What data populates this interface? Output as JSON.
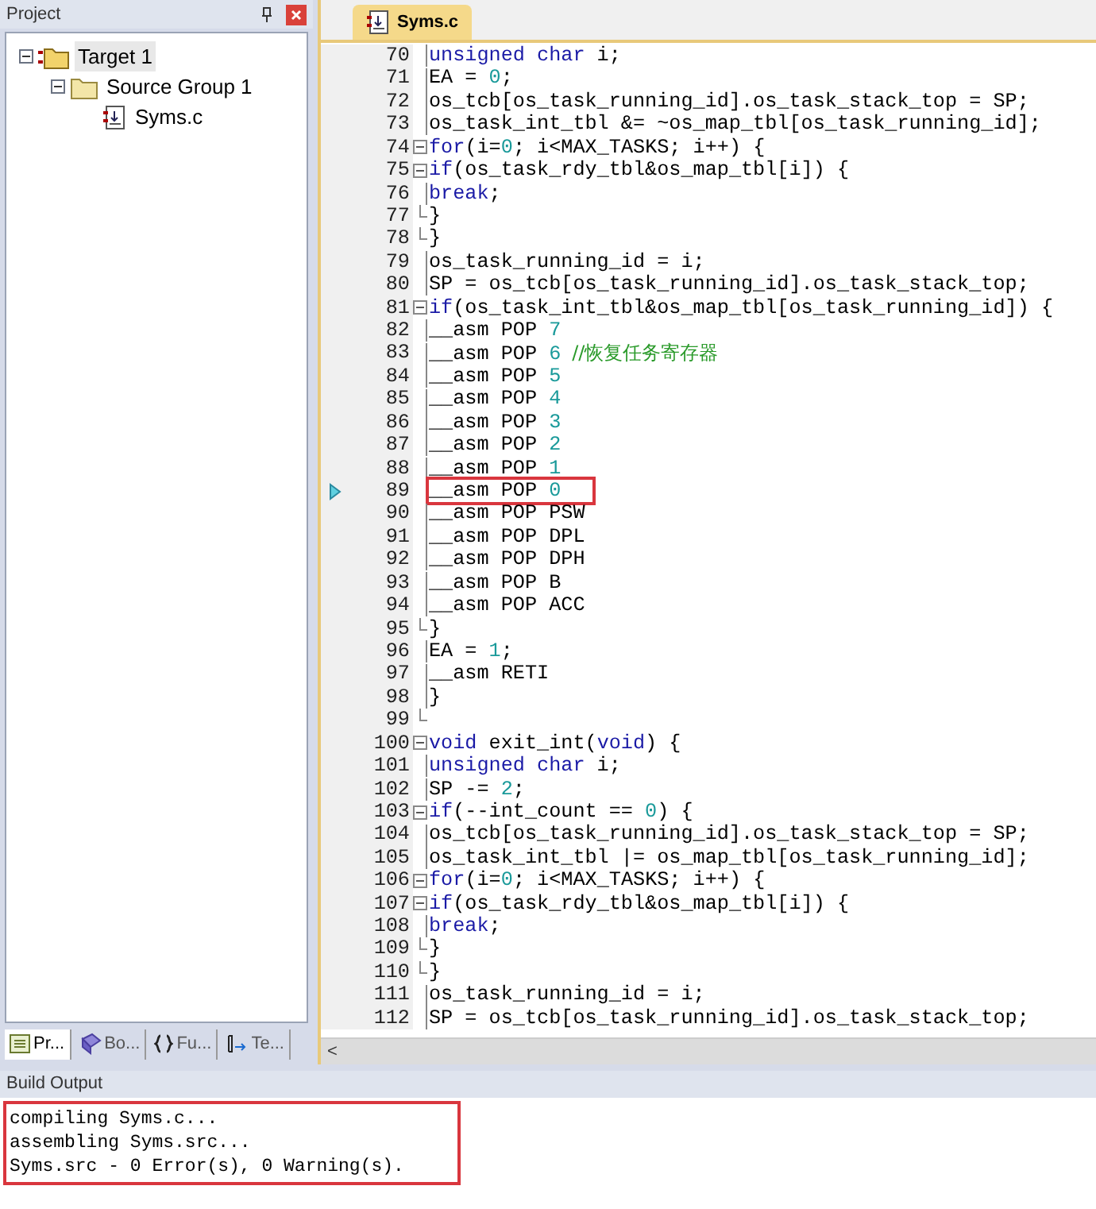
{
  "project_panel": {
    "title": "Project",
    "tree": [
      {
        "label": "Target 1",
        "kind": "target",
        "selected": true,
        "expanded": true,
        "children": [
          {
            "label": "Source Group 1",
            "kind": "group",
            "selected": false,
            "expanded": true,
            "children": [
              {
                "label": "Syms.c",
                "kind": "file",
                "selected": false
              }
            ]
          }
        ]
      }
    ],
    "tabs": [
      {
        "label": "Pr...",
        "kind": "project",
        "selected": true
      },
      {
        "label": "Bo...",
        "kind": "books",
        "selected": false
      },
      {
        "label": "Fu...",
        "kind": "functions",
        "selected": false
      },
      {
        "label": "Te...",
        "kind": "templates",
        "selected": false
      }
    ]
  },
  "editor": {
    "tab": {
      "label": "Syms.c",
      "selected": true
    },
    "lines": [
      {
        "number": "70",
        "kind": "code",
        "tokens": [
          {
            "kind": "keyword",
            "text": "unsigned char"
          },
          {
            "kind": "plain",
            "text": " i;"
          }
        ]
      },
      {
        "number": "71",
        "kind": "code",
        "tokens": [
          {
            "kind": "plain",
            "text": "EA = "
          },
          {
            "kind": "number",
            "text": "0"
          },
          {
            "kind": "plain",
            "text": ";"
          }
        ]
      },
      {
        "number": "72",
        "kind": "code",
        "tokens": [
          {
            "kind": "plain",
            "text": "os_tcb[os_task_running_id].os_task_stack_top = SP;"
          }
        ]
      },
      {
        "number": "73",
        "kind": "code",
        "tokens": [
          {
            "kind": "plain",
            "text": "os_task_int_tbl &= ~os_map_tbl[os_task_running_id];"
          }
        ]
      },
      {
        "number": "74",
        "kind": "block_start",
        "tokens": [
          {
            "kind": "keyword",
            "text": "for"
          },
          {
            "kind": "plain",
            "text": "(i="
          },
          {
            "kind": "number",
            "text": "0"
          },
          {
            "kind": "plain",
            "text": "; i<MAX_TASKS; i++) {"
          }
        ]
      },
      {
        "number": "75",
        "kind": "block_start",
        "tokens": [
          {
            "kind": "keyword",
            "text": "if"
          },
          {
            "kind": "plain",
            "text": "(os_task_rdy_tbl&os_map_tbl[i]) {"
          }
        ]
      },
      {
        "number": "76",
        "kind": "code",
        "tokens": [
          {
            "kind": "keyword",
            "text": "break"
          },
          {
            "kind": "plain",
            "text": ";"
          }
        ]
      },
      {
        "number": "77",
        "kind": "block_end",
        "tokens": [
          {
            "kind": "plain",
            "text": "}"
          }
        ]
      },
      {
        "number": "78",
        "kind": "block_end",
        "tokens": [
          {
            "kind": "plain",
            "text": "}"
          }
        ]
      },
      {
        "number": "79",
        "kind": "code",
        "tokens": [
          {
            "kind": "plain",
            "text": "os_task_running_id = i;"
          }
        ]
      },
      {
        "number": "80",
        "kind": "code",
        "tokens": [
          {
            "kind": "plain",
            "text": "SP = os_tcb[os_task_running_id].os_task_stack_top;"
          }
        ]
      },
      {
        "number": "81",
        "kind": "block_start",
        "tokens": [
          {
            "kind": "keyword",
            "text": "if"
          },
          {
            "kind": "plain",
            "text": "(os_task_int_tbl&os_map_tbl[os_task_running_id]) {"
          }
        ]
      },
      {
        "number": "82",
        "kind": "code",
        "tokens": [
          {
            "kind": "plain",
            "text": "__asm POP "
          },
          {
            "kind": "number",
            "text": "7"
          }
        ]
      },
      {
        "number": "83",
        "kind": "code",
        "tokens": [
          {
            "kind": "plain",
            "text": "__asm POP "
          },
          {
            "kind": "number",
            "text": "6"
          },
          {
            "kind": "comment",
            "text": "//恢复任务寄存器"
          }
        ]
      },
      {
        "number": "84",
        "kind": "code",
        "tokens": [
          {
            "kind": "plain",
            "text": "__asm POP "
          },
          {
            "kind": "number",
            "text": "5"
          }
        ]
      },
      {
        "number": "85",
        "kind": "code",
        "tokens": [
          {
            "kind": "plain",
            "text": "__asm POP "
          },
          {
            "kind": "number",
            "text": "4"
          }
        ]
      },
      {
        "number": "86",
        "kind": "code",
        "tokens": [
          {
            "kind": "plain",
            "text": "__asm POP "
          },
          {
            "kind": "number",
            "text": "3"
          }
        ]
      },
      {
        "number": "87",
        "kind": "code",
        "tokens": [
          {
            "kind": "plain",
            "text": "__asm POP "
          },
          {
            "kind": "number",
            "text": "2"
          }
        ]
      },
      {
        "number": "88",
        "kind": "code",
        "tokens": [
          {
            "kind": "plain",
            "text": "__asm POP "
          },
          {
            "kind": "number",
            "text": "1"
          }
        ]
      },
      {
        "number": "89",
        "kind": "code",
        "current": true,
        "highlighted": true,
        "tokens": [
          {
            "kind": "plain",
            "text": "__asm POP "
          },
          {
            "kind": "number",
            "text": "0"
          }
        ]
      },
      {
        "number": "90",
        "kind": "code",
        "tokens": [
          {
            "kind": "plain",
            "text": "__asm POP PSW"
          }
        ]
      },
      {
        "number": "91",
        "kind": "code",
        "tokens": [
          {
            "kind": "plain",
            "text": "__asm POP DPL"
          }
        ]
      },
      {
        "number": "92",
        "kind": "code",
        "tokens": [
          {
            "kind": "plain",
            "text": "__asm POP DPH"
          }
        ]
      },
      {
        "number": "93",
        "kind": "code",
        "tokens": [
          {
            "kind": "plain",
            "text": "__asm POP B"
          }
        ]
      },
      {
        "number": "94",
        "kind": "code",
        "tokens": [
          {
            "kind": "plain",
            "text": "__asm POP ACC"
          }
        ]
      },
      {
        "number": "95",
        "kind": "block_end",
        "tokens": [
          {
            "kind": "plain",
            "text": "}"
          }
        ]
      },
      {
        "number": "96",
        "kind": "code",
        "tokens": [
          {
            "kind": "plain",
            "text": "EA = "
          },
          {
            "kind": "number",
            "text": "1"
          },
          {
            "kind": "plain",
            "text": ";"
          }
        ]
      },
      {
        "number": "97",
        "kind": "code",
        "tokens": [
          {
            "kind": "plain",
            "text": "__asm RETI"
          }
        ]
      },
      {
        "number": "98",
        "kind": "code",
        "tokens": [
          {
            "kind": "plain",
            "text": "}"
          }
        ]
      },
      {
        "number": "99",
        "kind": "block_end"
      },
      {
        "number": "100",
        "kind": "block_start",
        "tokens": [
          {
            "kind": "keyword",
            "text": "void"
          },
          {
            "kind": "plain",
            "text": " exit_int("
          },
          {
            "kind": "keyword",
            "text": "void"
          },
          {
            "kind": "plain",
            "text": ") {"
          }
        ]
      },
      {
        "number": "101",
        "kind": "code",
        "tokens": [
          {
            "kind": "keyword",
            "text": "unsigned char"
          },
          {
            "kind": "plain",
            "text": " i;"
          }
        ]
      },
      {
        "number": "102",
        "kind": "code",
        "tokens": [
          {
            "kind": "plain",
            "text": "SP -= "
          },
          {
            "kind": "number",
            "text": "2"
          },
          {
            "kind": "plain",
            "text": ";"
          }
        ]
      },
      {
        "number": "103",
        "kind": "block_start",
        "tokens": [
          {
            "kind": "keyword",
            "text": "if"
          },
          {
            "kind": "plain",
            "text": "(--int_count == "
          },
          {
            "kind": "number",
            "text": "0"
          },
          {
            "kind": "plain",
            "text": ") {"
          }
        ]
      },
      {
        "number": "104",
        "kind": "code",
        "tokens": [
          {
            "kind": "plain",
            "text": "os_tcb[os_task_running_id].os_task_stack_top = SP;"
          }
        ]
      },
      {
        "number": "105",
        "kind": "code",
        "tokens": [
          {
            "kind": "plain",
            "text": "os_task_int_tbl |= os_map_tbl[os_task_running_id];"
          }
        ]
      },
      {
        "number": "106",
        "kind": "block_start",
        "tokens": [
          {
            "kind": "keyword",
            "text": "for"
          },
          {
            "kind": "plain",
            "text": "(i="
          },
          {
            "kind": "number",
            "text": "0"
          },
          {
            "kind": "plain",
            "text": "; i<MAX_TASKS; i++) {"
          }
        ]
      },
      {
        "number": "107",
        "kind": "block_start",
        "tokens": [
          {
            "kind": "keyword",
            "text": "if"
          },
          {
            "kind": "plain",
            "text": "(os_task_rdy_tbl&os_map_tbl[i]) {"
          }
        ]
      },
      {
        "number": "108",
        "kind": "code",
        "tokens": [
          {
            "kind": "keyword",
            "text": "break"
          },
          {
            "kind": "plain",
            "text": ";"
          }
        ]
      },
      {
        "number": "109",
        "kind": "block_end",
        "tokens": [
          {
            "kind": "plain",
            "text": "}"
          }
        ]
      },
      {
        "number": "110",
        "kind": "block_end",
        "tokens": [
          {
            "kind": "plain",
            "text": "}"
          }
        ]
      },
      {
        "number": "111",
        "kind": "code",
        "tokens": [
          {
            "kind": "plain",
            "text": "os_task_running_id = i;"
          }
        ]
      },
      {
        "number": "112",
        "kind": "code",
        "tokens": [
          {
            "kind": "plain",
            "text": "SP = os_tcb[os_task_running_id].os_task_stack_top;"
          }
        ]
      }
    ],
    "scroll_left": "<"
  },
  "build_output": {
    "title": "Build Output",
    "highlighted": true,
    "lines": [
      "compiling Syms.c...",
      "assembling Syms.src...",
      "Syms.src - 0 Error(s), 0 Warning(s)."
    ]
  }
}
